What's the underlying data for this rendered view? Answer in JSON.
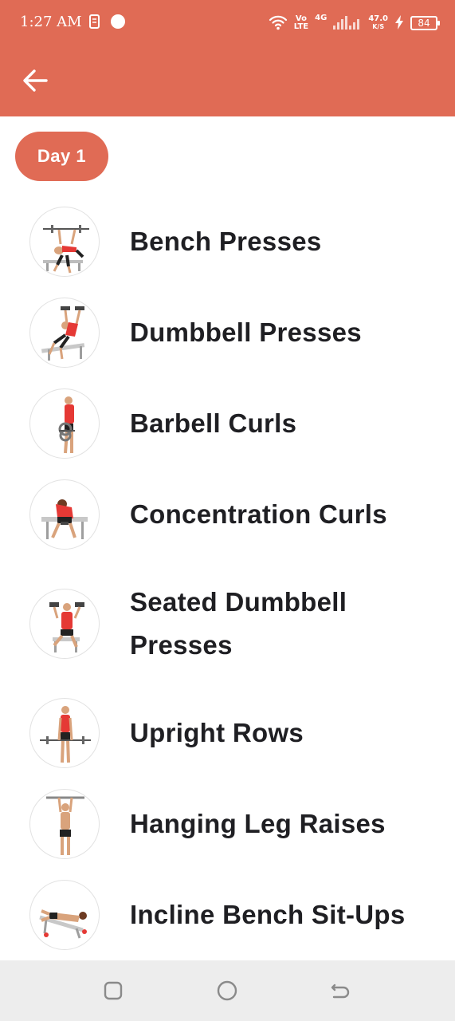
{
  "status_bar": {
    "time": "1:27 AM",
    "volte_top": "Vo",
    "volte_bottom": "LTE",
    "network": "4G",
    "speed_value": "47.0",
    "speed_unit": "K/S",
    "battery": "84",
    "icons": [
      "sim-toolkit-icon",
      "dot-icon",
      "wifi-icon",
      "signal-icon",
      "charging-icon",
      "battery-icon"
    ]
  },
  "header": {
    "back_icon": "arrow-left-icon",
    "background_color": "#e06b55"
  },
  "day_chip": {
    "label": "Day 1"
  },
  "exercises": [
    {
      "name": "Bench Presses",
      "icon": "bench-press-figure"
    },
    {
      "name": "Dumbbell Presses",
      "icon": "dumbbell-press-figure"
    },
    {
      "name": "Barbell Curls",
      "icon": "barbell-curl-figure"
    },
    {
      "name": "Concentration Curls",
      "icon": "concentration-curl-figure"
    },
    {
      "name": "Seated Dumbbell Presses",
      "icon": "seated-dumbbell-press-figure"
    },
    {
      "name": "Upright Rows",
      "icon": "upright-row-figure"
    },
    {
      "name": "Hanging Leg Raises",
      "icon": "hanging-leg-raise-figure"
    },
    {
      "name": "Incline Bench Sit-Ups",
      "icon": "incline-sit-up-figure"
    }
  ],
  "nav_bar": {
    "icons": [
      "recents-icon",
      "home-icon",
      "back-nav-icon"
    ]
  }
}
